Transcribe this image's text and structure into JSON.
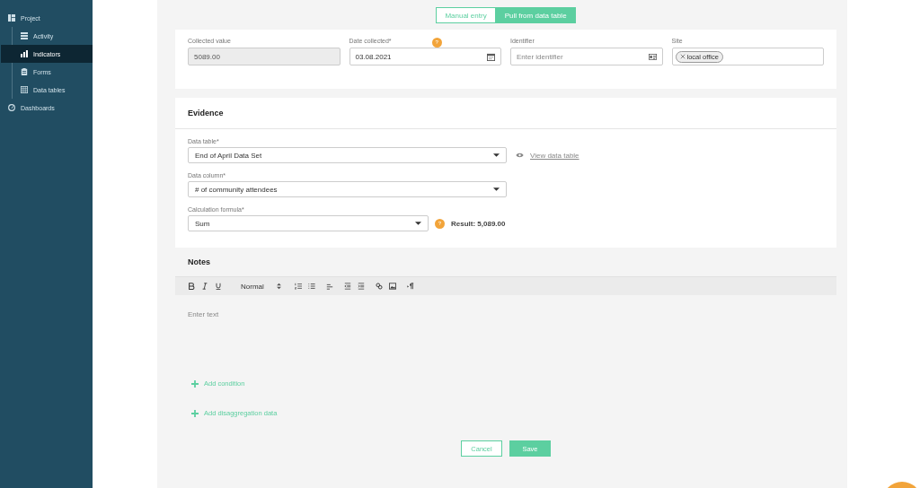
{
  "sidebar": {
    "items": [
      {
        "label": "Project",
        "selected": false,
        "children": [
          {
            "label": "Activity",
            "selected": false
          },
          {
            "label": "Indicators",
            "selected": true
          },
          {
            "label": "Forms",
            "selected": false
          },
          {
            "label": "Data tables",
            "selected": false
          }
        ]
      },
      {
        "label": "Dashboards",
        "selected": false
      }
    ]
  },
  "mode_tabs": [
    {
      "label": "Manual entry",
      "selected": false
    },
    {
      "label": "Pull from data table",
      "selected": true
    }
  ],
  "fields": [
    {
      "label": "Collected value",
      "value": "5089.00",
      "disabled": true,
      "kind": "text"
    },
    {
      "label": "Date collected*",
      "value": "03.08.2021",
      "disabled": false,
      "kind": "date",
      "help": "?"
    },
    {
      "label": "Identifier",
      "placeholder": "Enter identifier",
      "disabled": false,
      "kind": "id"
    },
    {
      "label": "Site",
      "tags": [
        "local office"
      ],
      "disabled": false,
      "kind": "tags"
    }
  ],
  "evidence": {
    "title": "Evidence",
    "data_table": {
      "label": "Data table*",
      "value": "End of April Data Set",
      "link": "View data table"
    },
    "data_column": {
      "label": "Data column*",
      "value": "# of community attendees"
    },
    "formula": {
      "label": "Calculation formula*",
      "value": "Sum",
      "help": "?",
      "result": "Result: 5,089.00"
    }
  },
  "notes": {
    "title": "Notes",
    "style": "Normal",
    "placeholder": "Enter text"
  },
  "actions": [
    "Add condition",
    "Add disaggregation data"
  ],
  "buttons": [
    {
      "label": "Cancel",
      "kind": "secondary"
    },
    {
      "label": "Save",
      "kind": "primary"
    }
  ]
}
